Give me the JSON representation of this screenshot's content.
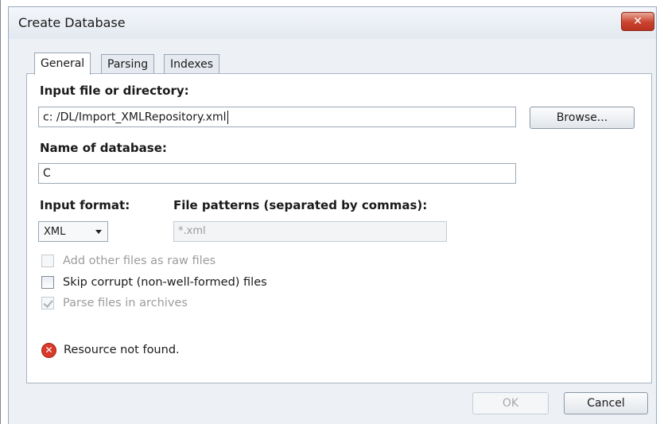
{
  "window": {
    "title": "Create Database",
    "close_glyph": "✕"
  },
  "tabs": [
    {
      "label": "General",
      "active": true
    },
    {
      "label": "Parsing",
      "active": false
    },
    {
      "label": "Indexes",
      "active": false
    }
  ],
  "form": {
    "input_label": "Input file or directory:",
    "input_value": "c: /DL/Import_XMLRepository.xml",
    "browse_label": "Browse...",
    "name_label": "Name of database:",
    "name_value": "C",
    "format_label": "Input format:",
    "format_value": "XML",
    "patterns_label": "File patterns (separated by commas):",
    "patterns_value": "*.xml"
  },
  "options": [
    {
      "label": "Add other files as raw files",
      "checked": false,
      "enabled": false
    },
    {
      "label": "Skip corrupt (non-well-formed) files",
      "checked": false,
      "enabled": true
    },
    {
      "label": "Parse files in archives",
      "checked": true,
      "enabled": false
    }
  ],
  "status": {
    "icon": "error-icon",
    "message": "Resource not found."
  },
  "footer": {
    "ok_label": "OK",
    "cancel_label": "Cancel"
  },
  "colors": {
    "error": "#d83a2b",
    "close_button": "#c9432e"
  }
}
